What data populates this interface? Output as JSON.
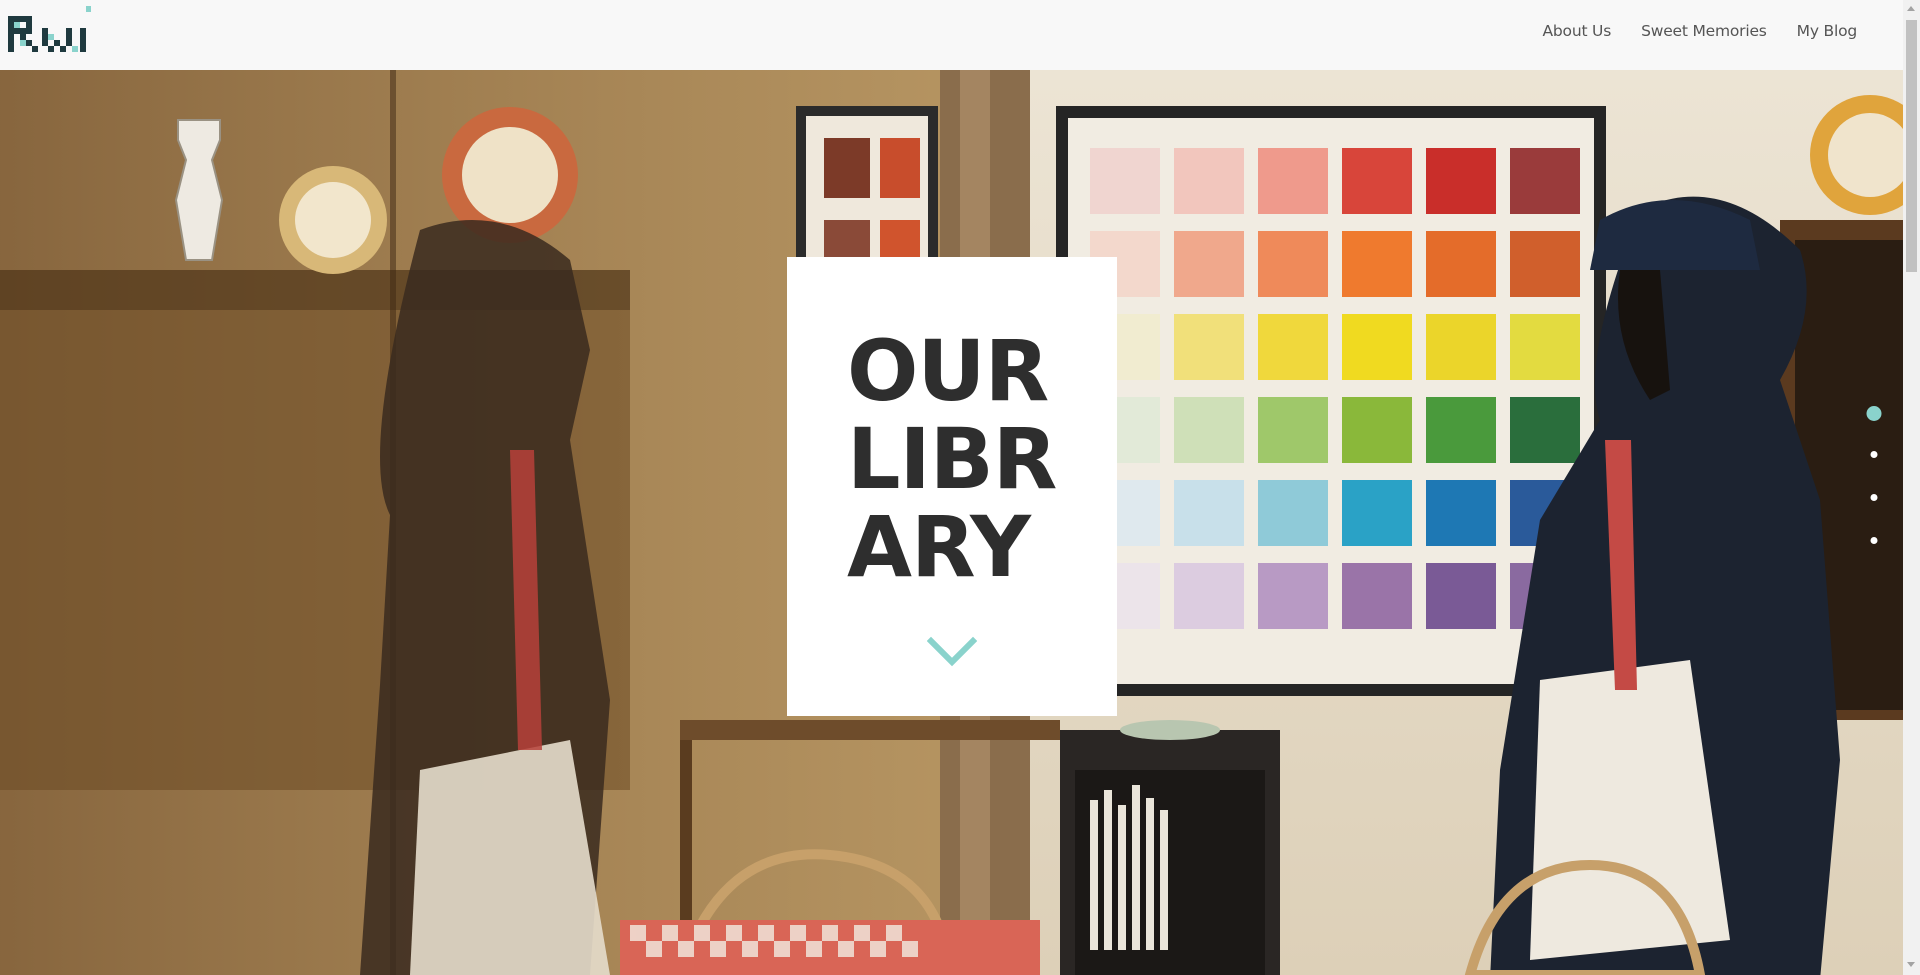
{
  "nav": {
    "items": [
      {
        "label": "About Us"
      },
      {
        "label": "Sweet Memories"
      },
      {
        "label": "My Blog"
      }
    ]
  },
  "hero": {
    "title_lines": [
      "OUR",
      "LIBR",
      "ARY"
    ]
  },
  "slider": {
    "active_index": 0
  },
  "colors": {
    "accent": "#8ad3cc",
    "logo_dark": "#1f3a3f",
    "title_text": "#2e2e2e",
    "nav_text": "#555555"
  },
  "icons": {
    "logo": "pixel-logo",
    "scroll_down": "chevron-down-icon"
  }
}
